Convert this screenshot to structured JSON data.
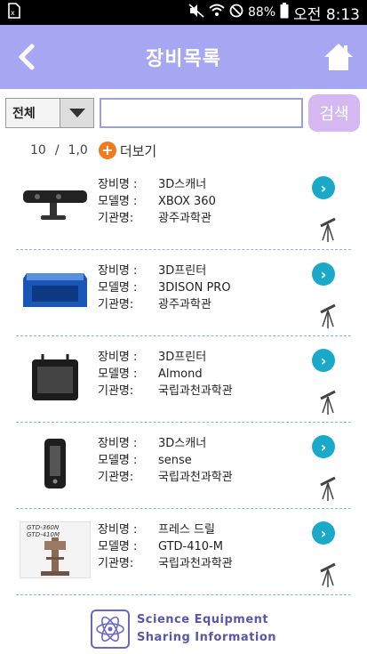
{
  "status": {
    "battery": "88%",
    "time": "오전 8:13"
  },
  "header": {
    "title": "장비목록"
  },
  "search": {
    "category": "전체",
    "input_value": "",
    "button_label": "검색"
  },
  "pagination": {
    "shown": "10",
    "total": "1,0",
    "more_label": "더보기"
  },
  "labels": {
    "name": "장비명 :",
    "model": "모델명 :",
    "org": "기관명:"
  },
  "items": [
    {
      "name": "3D스캐너",
      "model": "XBOX 360",
      "org": "광주과학관"
    },
    {
      "name": "3D프린터",
      "model": "3DISON PRO",
      "org": "광주과학관"
    },
    {
      "name": "3D프린터",
      "model": "Almond",
      "org": "국립과천과학관"
    },
    {
      "name": "3D스캐너",
      "model": "sense",
      "org": "국립과천과학관"
    },
    {
      "name": "프레스 드릴",
      "model": "GTD-410-M",
      "org": "국립과천과학관"
    }
  ],
  "thumb_text": {
    "line1": "GTD-360N",
    "line2": "GTD-410M"
  },
  "footer": {
    "line1": "Science Equipment",
    "line2": "Sharing Information"
  },
  "colors": {
    "header": "#a7a6f2",
    "accent": "#1aa9c9",
    "plus": "#f07a1e"
  }
}
